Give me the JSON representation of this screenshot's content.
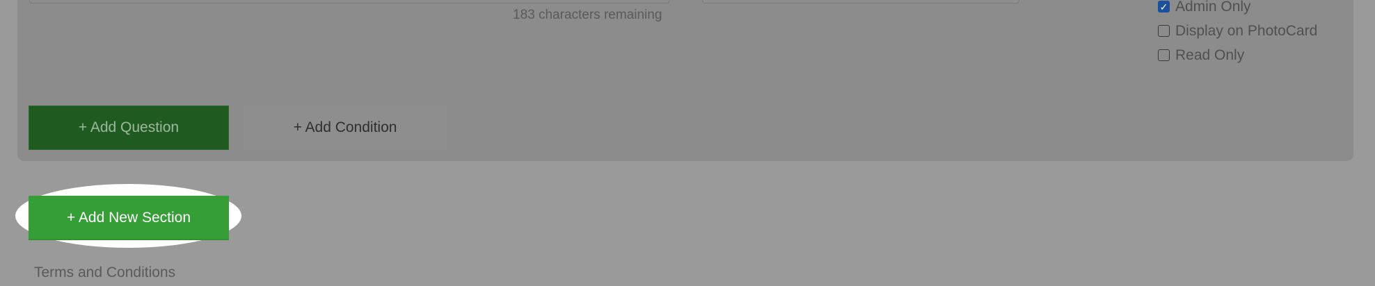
{
  "question_block": {
    "chars_remaining": "183 characters remaining",
    "options": [
      {
        "label": "Admin Only",
        "checked": true
      },
      {
        "label": "Display on PhotoCard",
        "checked": false
      },
      {
        "label": "Read Only",
        "checked": false
      }
    ],
    "add_question_label": "+ Add Question",
    "add_condition_label": "+ Add Condition"
  },
  "add_section_label": "+ Add New Section",
  "terms_label": "Terms and Conditions",
  "colors": {
    "primary_green": "#359e36",
    "dark_green": "#1f5b21",
    "overlay": "#9a9a9a"
  }
}
